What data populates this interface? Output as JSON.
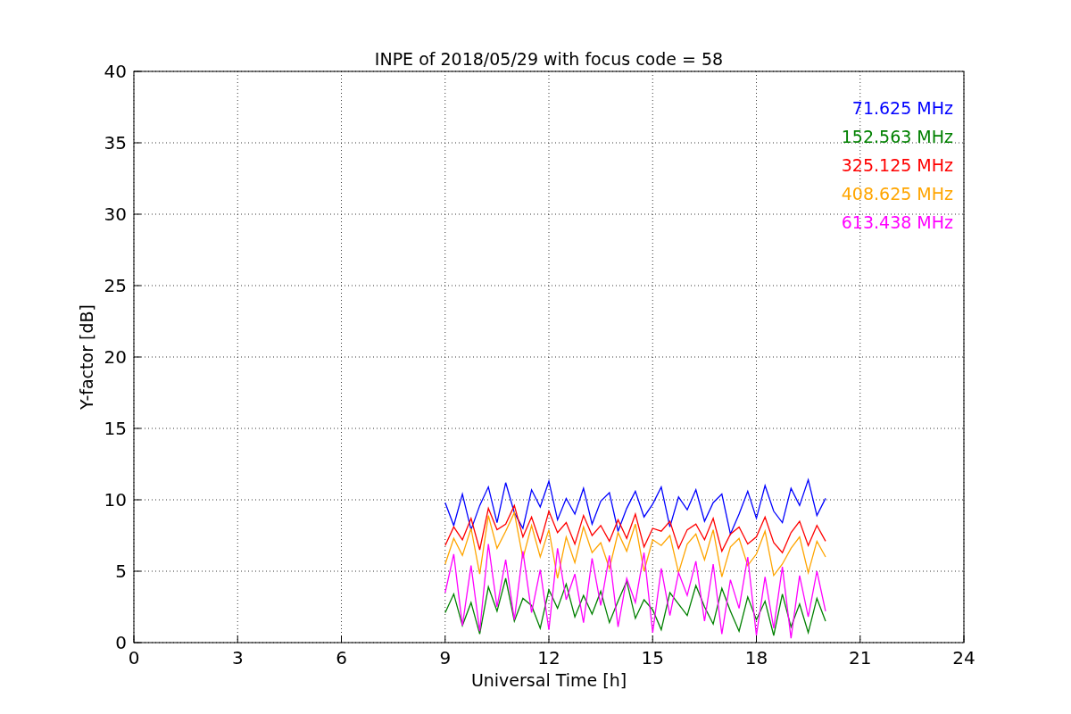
{
  "chart_data": {
    "type": "line",
    "title": "INPE of 2018/05/29 with focus code = 58",
    "xlabel": "Universal Time [h]",
    "ylabel": "Y-factor [dB]",
    "xlim": [
      0,
      24
    ],
    "ylim": [
      0,
      40
    ],
    "xticks": [
      0,
      3,
      6,
      9,
      12,
      15,
      18,
      21,
      24
    ],
    "yticks": [
      0,
      5,
      10,
      15,
      20,
      25,
      30,
      35,
      40
    ],
    "grid": true,
    "x": [
      9,
      9.25,
      9.5,
      9.75,
      10,
      10.25,
      10.5,
      10.75,
      11,
      11.25,
      11.5,
      11.75,
      12,
      12.25,
      12.5,
      12.75,
      13,
      13.25,
      13.5,
      13.75,
      14,
      14.25,
      14.5,
      14.75,
      15,
      15.25,
      15.5,
      15.75,
      16,
      16.25,
      16.5,
      16.75,
      17,
      17.25,
      17.5,
      17.75,
      18,
      18.25,
      18.5,
      18.75,
      19,
      19.25,
      19.5,
      19.75,
      20
    ],
    "series": [
      {
        "name": "71.625 MHz",
        "color": "#0000ff",
        "values": [
          9.8,
          8.2,
          10.4,
          7.9,
          9.6,
          10.9,
          8.4,
          11.2,
          9.1,
          8.0,
          10.7,
          9.5,
          11.3,
          8.6,
          10.1,
          9.0,
          10.8,
          8.3,
          9.9,
          10.5,
          7.8,
          9.4,
          10.6,
          8.8,
          9.7,
          10.9,
          8.1,
          10.2,
          9.3,
          10.7,
          8.5,
          9.8,
          10.4,
          7.6,
          9.0,
          10.6,
          8.7,
          11.0,
          9.2,
          8.4,
          10.8,
          9.6,
          11.4,
          8.9,
          10.1
        ]
      },
      {
        "name": "152.563 MHz",
        "color": "#008000",
        "values": [
          2.1,
          3.4,
          1.2,
          2.8,
          0.6,
          3.9,
          2.2,
          4.5,
          1.5,
          3.1,
          2.6,
          1.0,
          3.7,
          2.4,
          4.1,
          1.8,
          3.3,
          2.0,
          3.6,
          1.4,
          2.9,
          4.3,
          1.7,
          3.0,
          2.3,
          0.9,
          3.5,
          2.7,
          1.9,
          4.0,
          2.5,
          1.3,
          3.8,
          2.2,
          0.8,
          3.2,
          1.6,
          2.9,
          0.5,
          3.4,
          1.1,
          2.7,
          0.7,
          3.1,
          1.5
        ]
      },
      {
        "name": "325.125 MHz",
        "color": "#ff0000",
        "values": [
          6.8,
          8.1,
          7.2,
          8.7,
          6.5,
          9.4,
          7.9,
          8.3,
          9.6,
          7.4,
          8.8,
          7.0,
          9.2,
          7.7,
          8.4,
          6.9,
          8.9,
          7.5,
          8.2,
          7.1,
          8.6,
          7.3,
          9.0,
          6.7,
          8.0,
          7.8,
          8.5,
          6.6,
          7.9,
          8.3,
          7.2,
          8.7,
          6.4,
          7.6,
          8.1,
          6.9,
          7.4,
          8.8,
          7.0,
          6.3,
          7.7,
          8.5,
          6.8,
          8.2,
          7.1
        ]
      },
      {
        "name": "408.625 MHz",
        "color": "#ffa500",
        "values": [
          5.5,
          7.3,
          6.1,
          8.0,
          4.8,
          8.9,
          6.6,
          7.8,
          9.1,
          5.9,
          8.2,
          6.0,
          7.9,
          4.5,
          7.4,
          5.6,
          8.1,
          6.3,
          7.0,
          5.2,
          7.7,
          6.4,
          8.3,
          5.0,
          7.2,
          6.8,
          7.5,
          4.9,
          6.9,
          7.6,
          5.8,
          7.9,
          4.6,
          6.7,
          7.3,
          5.4,
          6.2,
          7.8,
          4.7,
          5.5,
          6.6,
          7.4,
          4.9,
          7.1,
          6.0
        ]
      },
      {
        "name": "613.438 MHz",
        "color": "#ff00ff",
        "values": [
          3.5,
          6.2,
          1.2,
          5.4,
          0.8,
          6.9,
          2.5,
          5.8,
          1.6,
          6.4,
          2.1,
          5.1,
          0.9,
          6.6,
          3.0,
          4.8,
          1.4,
          5.9,
          2.6,
          6.1,
          1.1,
          4.5,
          2.8,
          6.3,
          0.7,
          5.2,
          1.9,
          4.9,
          3.3,
          5.7,
          1.5,
          5.5,
          0.6,
          4.4,
          2.4,
          6.0,
          0.5,
          4.6,
          1.0,
          5.3,
          0.3,
          4.7,
          1.8,
          5.0,
          2.2
        ]
      }
    ]
  }
}
